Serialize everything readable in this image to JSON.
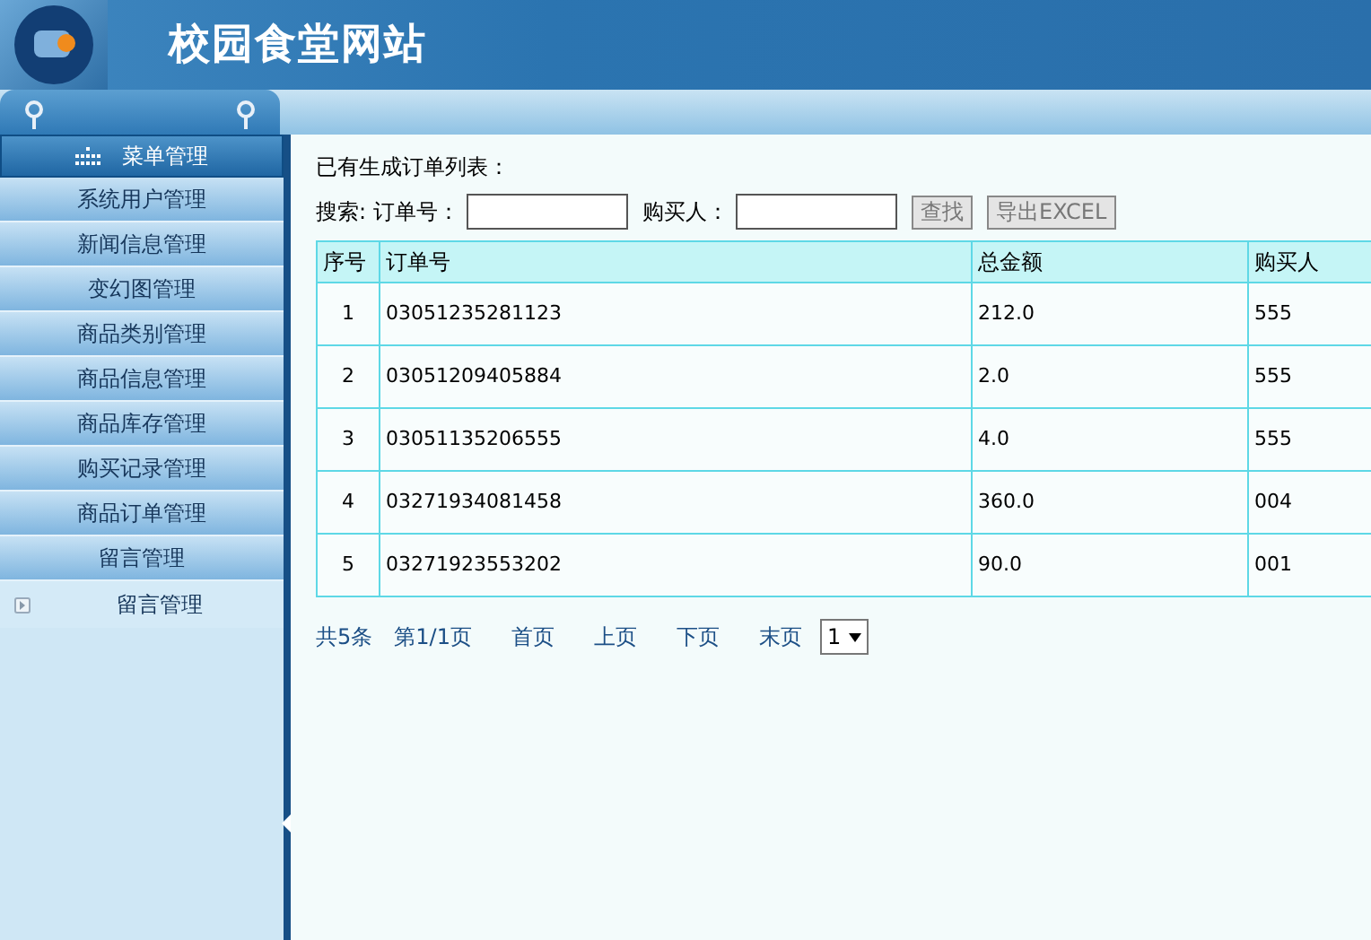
{
  "site_title": "校园食堂网站",
  "sidebar": {
    "header": "菜单管理",
    "items": [
      {
        "label": "系统用户管理",
        "kind": "section"
      },
      {
        "label": "新闻信息管理",
        "kind": "section"
      },
      {
        "label": "变幻图管理",
        "kind": "section"
      },
      {
        "label": "商品类别管理",
        "kind": "section"
      },
      {
        "label": "商品信息管理",
        "kind": "section"
      },
      {
        "label": "商品库存管理",
        "kind": "section"
      },
      {
        "label": "购买记录管理",
        "kind": "section"
      },
      {
        "label": "商品订单管理",
        "kind": "section"
      },
      {
        "label": "留言管理",
        "kind": "section"
      },
      {
        "label": "留言管理",
        "kind": "link"
      }
    ]
  },
  "content": {
    "heading": "已有生成订单列表：",
    "search_label": "搜索:",
    "fields": [
      {
        "label": "订单号："
      },
      {
        "label": "购买人："
      }
    ],
    "buttons": [
      "查找",
      "导出EXCEL"
    ],
    "table": {
      "columns": [
        "序号",
        "订单号",
        "总金额",
        "购买人"
      ],
      "rows": [
        [
          "1",
          "03051235281123",
          "212.0",
          "555"
        ],
        [
          "2",
          "03051209405884",
          "2.0",
          "555"
        ],
        [
          "3",
          "03051135206555",
          "4.0",
          "555"
        ],
        [
          "4",
          "03271934081458",
          "360.0",
          "004"
        ],
        [
          "5",
          "03271923553202",
          "90.0",
          "001"
        ]
      ]
    },
    "pager": {
      "total": "共5条",
      "page": "第1/1页",
      "links": [
        "首页",
        "上页",
        "下页",
        "末页"
      ],
      "select": "1"
    }
  }
}
